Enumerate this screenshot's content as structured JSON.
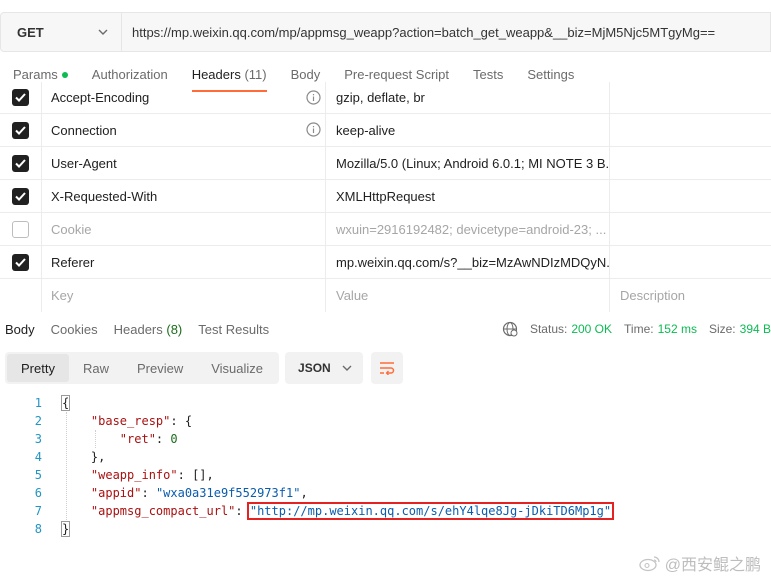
{
  "request": {
    "method": "GET",
    "url": "https://mp.weixin.qq.com/mp/appmsg_weapp?action=batch_get_weapp&__biz=MjM5Njc5MTgyMg=="
  },
  "request_tabs": [
    {
      "label": "Params"
    },
    {
      "label": "Authorization"
    },
    {
      "label": "Headers",
      "count": "(11)"
    },
    {
      "label": "Body"
    },
    {
      "label": "Pre-request Script"
    },
    {
      "label": "Tests"
    },
    {
      "label": "Settings"
    }
  ],
  "headers": [
    {
      "key": "Accept-Encoding",
      "value": "gzip, deflate, br",
      "enabled": true
    },
    {
      "key": "Connection",
      "value": "keep-alive",
      "enabled": true
    },
    {
      "key": "User-Agent",
      "value": "Mozilla/5.0 (Linux; Android 6.0.1; MI NOTE 3 B...",
      "enabled": true
    },
    {
      "key": "X-Requested-With",
      "value": "XMLHttpRequest",
      "enabled": true
    },
    {
      "key": "Cookie",
      "value": "wxuin=2916192482; devicetype=android-23; ...",
      "enabled": false
    },
    {
      "key": "Referer",
      "value": "mp.weixin.qq.com/s?__biz=MzAwNDIzMDQyN...",
      "enabled": true
    }
  ],
  "headers_placeholder": {
    "key": "Key",
    "value": "Value",
    "description": "Description"
  },
  "response_tabs": [
    {
      "label": "Body"
    },
    {
      "label": "Cookies"
    },
    {
      "label": "Headers",
      "count": "(8)"
    },
    {
      "label": "Test Results"
    }
  ],
  "status": {
    "status_label": "Status:",
    "status_value": "200 OK",
    "time_label": "Time:",
    "time_value": "152 ms",
    "size_label": "Size:",
    "size_value": "394 B"
  },
  "view_modes": [
    "Pretty",
    "Raw",
    "Preview",
    "Visualize"
  ],
  "format": "JSON",
  "code_lines": [
    "1",
    "2",
    "3",
    "4",
    "5",
    "6",
    "7",
    "8"
  ],
  "json": {
    "open": "{",
    "close": "}",
    "base_resp_key": "\"base_resp\"",
    "ret_key": "\"ret\"",
    "ret_value": "0",
    "weapp_info_key": "\"weapp_info\"",
    "weapp_info_value": "[]",
    "appid_key": "\"appid\"",
    "appid_value": "\"wxa0a31e9f552973f1\"",
    "compact_url_key": "\"appmsg_compact_url\"",
    "compact_url_value": "\"http://mp.weixin.qq.com/s/ehY4lqe8Jg-jDkiTD6Mp1g\""
  },
  "watermark": "@西安鲲之鹏",
  "colors": {
    "accent": "#ff6c37",
    "status_ok": "#0cbb52",
    "highlight_box": "#e52222"
  }
}
